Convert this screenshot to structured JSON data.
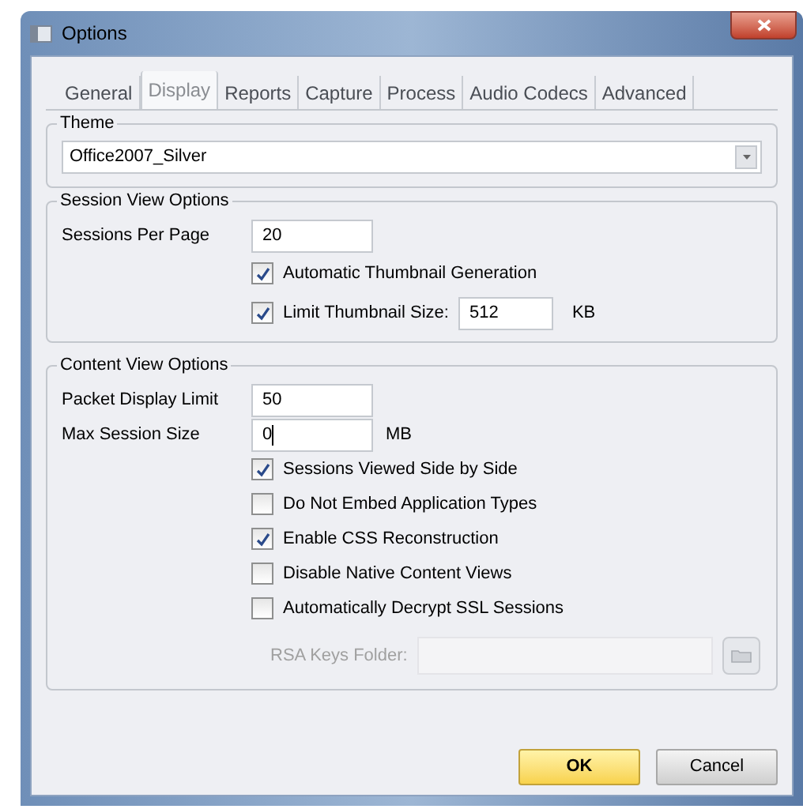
{
  "window": {
    "title": "Options"
  },
  "tabs": [
    {
      "label": "General",
      "selected": false
    },
    {
      "label": "Display",
      "selected": true
    },
    {
      "label": "Reports",
      "selected": false
    },
    {
      "label": "Capture",
      "selected": false
    },
    {
      "label": "Process",
      "selected": false
    },
    {
      "label": "Audio Codecs",
      "selected": false
    },
    {
      "label": "Advanced",
      "selected": false
    }
  ],
  "theme": {
    "title": "Theme",
    "value": "Office2007_Silver"
  },
  "session_view": {
    "title": "Session View Options",
    "rows": [
      {
        "kind": "field",
        "label": "Sessions Per Page",
        "value": "20"
      },
      {
        "kind": "checkbox",
        "label": "Automatic Thumbnail Generation",
        "checked": true
      },
      {
        "kind": "checkbox_field",
        "label": "Limit Thumbnail Size:",
        "checked": true,
        "value": "512",
        "unit": "KB"
      }
    ]
  },
  "content_view": {
    "title": "Content View Options",
    "rows": [
      {
        "kind": "field",
        "label": "Packet Display Limit",
        "value": "50"
      },
      {
        "kind": "field",
        "label": "Max Session Size",
        "value": "0",
        "unit": "MB",
        "focused": true
      },
      {
        "kind": "checkbox",
        "label": "Sessions Viewed Side by Side",
        "checked": true
      },
      {
        "kind": "checkbox",
        "label": "Do Not Embed Application Types",
        "checked": false
      },
      {
        "kind": "checkbox",
        "label": "Enable CSS Reconstruction",
        "checked": true
      },
      {
        "kind": "checkbox",
        "label": "Disable Native Content Views",
        "checked": false
      },
      {
        "kind": "checkbox",
        "label": "Automatically Decrypt SSL Sessions",
        "checked": false
      },
      {
        "kind": "folder",
        "label": "RSA Keys Folder:",
        "disabled": true
      }
    ]
  },
  "buttons": [
    {
      "label": "OK",
      "default": true
    },
    {
      "label": "Cancel",
      "default": false
    }
  ]
}
